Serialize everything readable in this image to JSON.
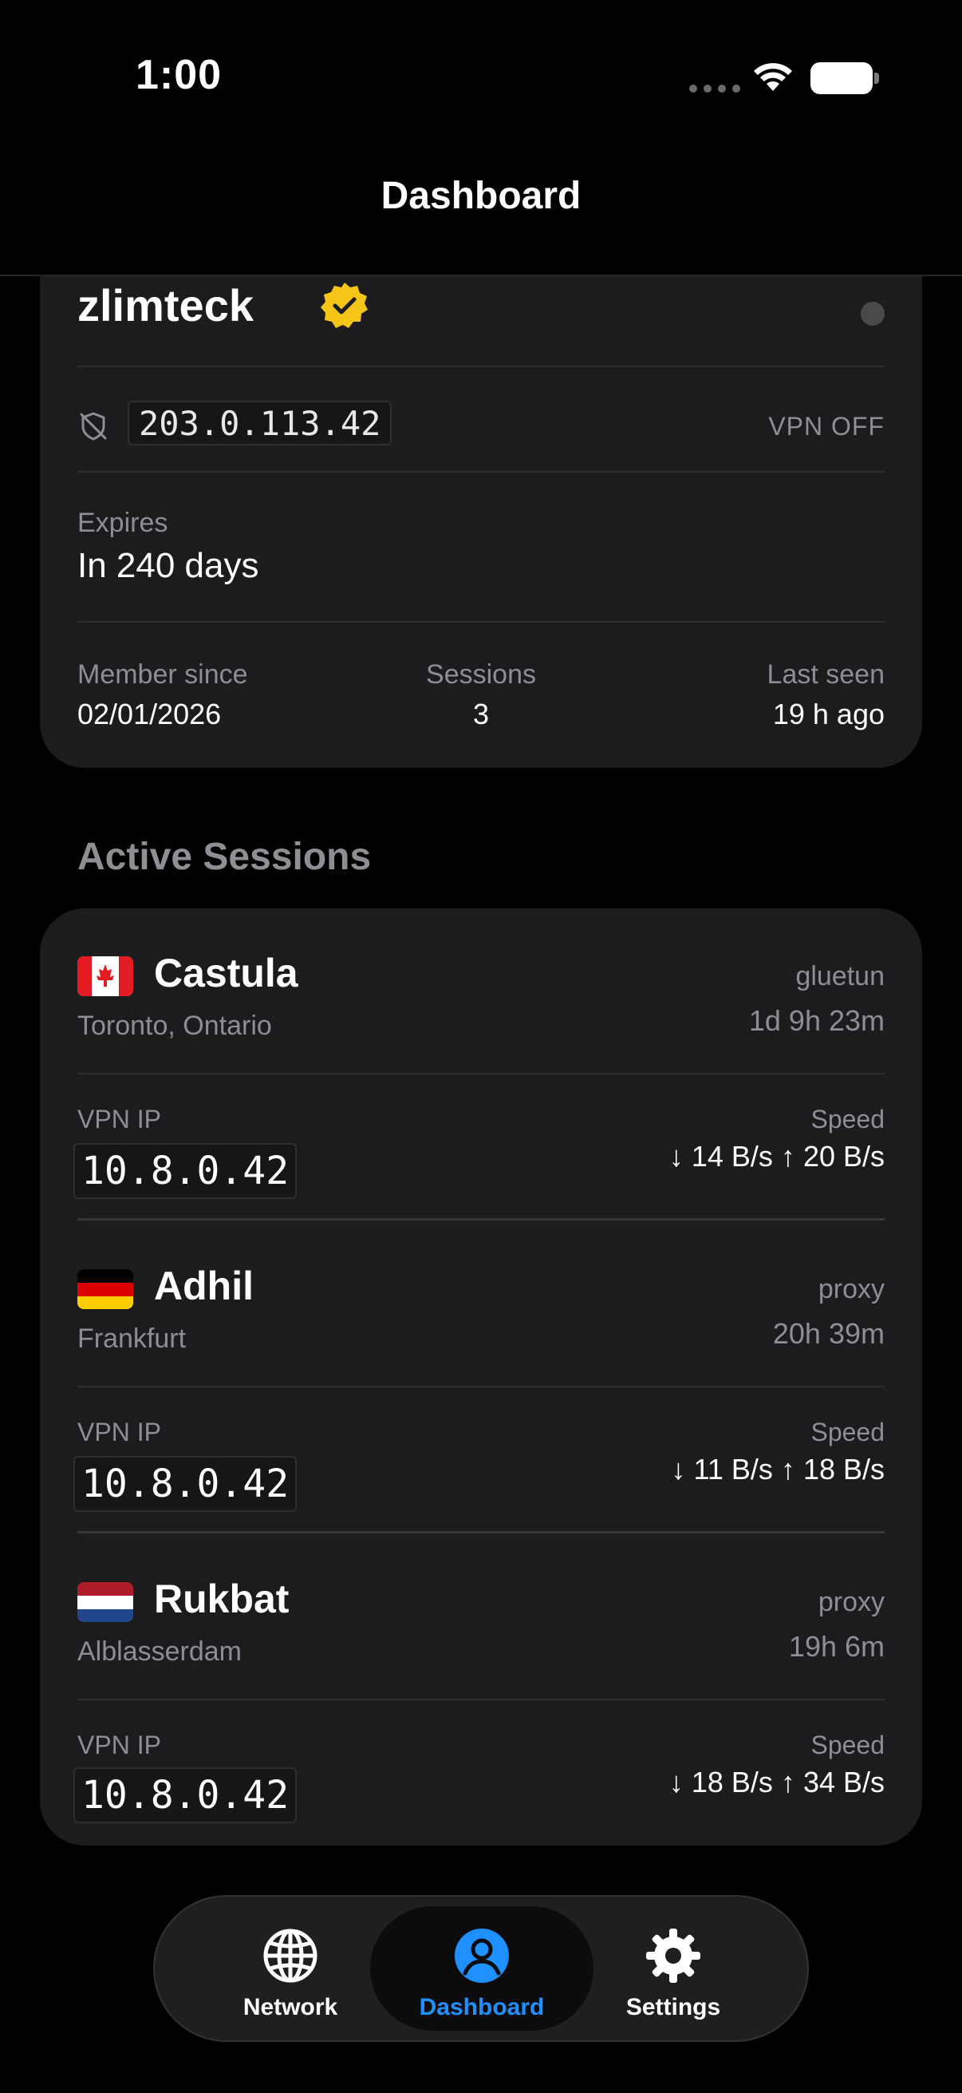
{
  "status_bar": {
    "time": "1:00"
  },
  "nav": {
    "title": "Dashboard"
  },
  "profile": {
    "username": "zlimteck",
    "ip_address": "203.0.113.42",
    "vpn_status": "VPN OFF",
    "expires_label": "Expires",
    "expires_value": "In 240 days",
    "member_since_label": "Member since",
    "member_since_value": "02/01/2026",
    "sessions_label": "Sessions",
    "sessions_value": "3",
    "last_seen_label": "Last seen",
    "last_seen_value": "19 h ago"
  },
  "sessions_section": {
    "title": "Active Sessions",
    "vpn_ip_label": "VPN IP",
    "speed_label": "Speed",
    "items": [
      {
        "server": "Castula",
        "location": "Toronto, Ontario",
        "type": "gluetun",
        "duration": "1d 9h 23m",
        "vpn_ip": "10.8.0.42",
        "speed": "↓ 14 B/s ↑ 20 B/s",
        "flag": "canada-flag"
      },
      {
        "server": "Adhil",
        "location": "Frankfurt",
        "type": "proxy",
        "duration": "20h 39m",
        "vpn_ip": "10.8.0.42",
        "speed": "↓ 11 B/s ↑ 18 B/s",
        "flag": "germany-flag"
      },
      {
        "server": "Rukbat",
        "location": "Alblasserdam",
        "type": "proxy",
        "duration": "19h 6m",
        "vpn_ip": "10.8.0.42",
        "speed": "↓ 18 B/s ↑ 34 B/s",
        "flag": "netherlands-flag"
      }
    ]
  },
  "tab_bar": {
    "network_label": "Network",
    "dashboard_label": "Dashboard",
    "settings_label": "Settings"
  },
  "colors": {
    "background": "#000000",
    "card": "#1c1c1e",
    "secondary_text": "#8e8e93",
    "accent": "#1e90ff",
    "verified": "#f5c518"
  }
}
